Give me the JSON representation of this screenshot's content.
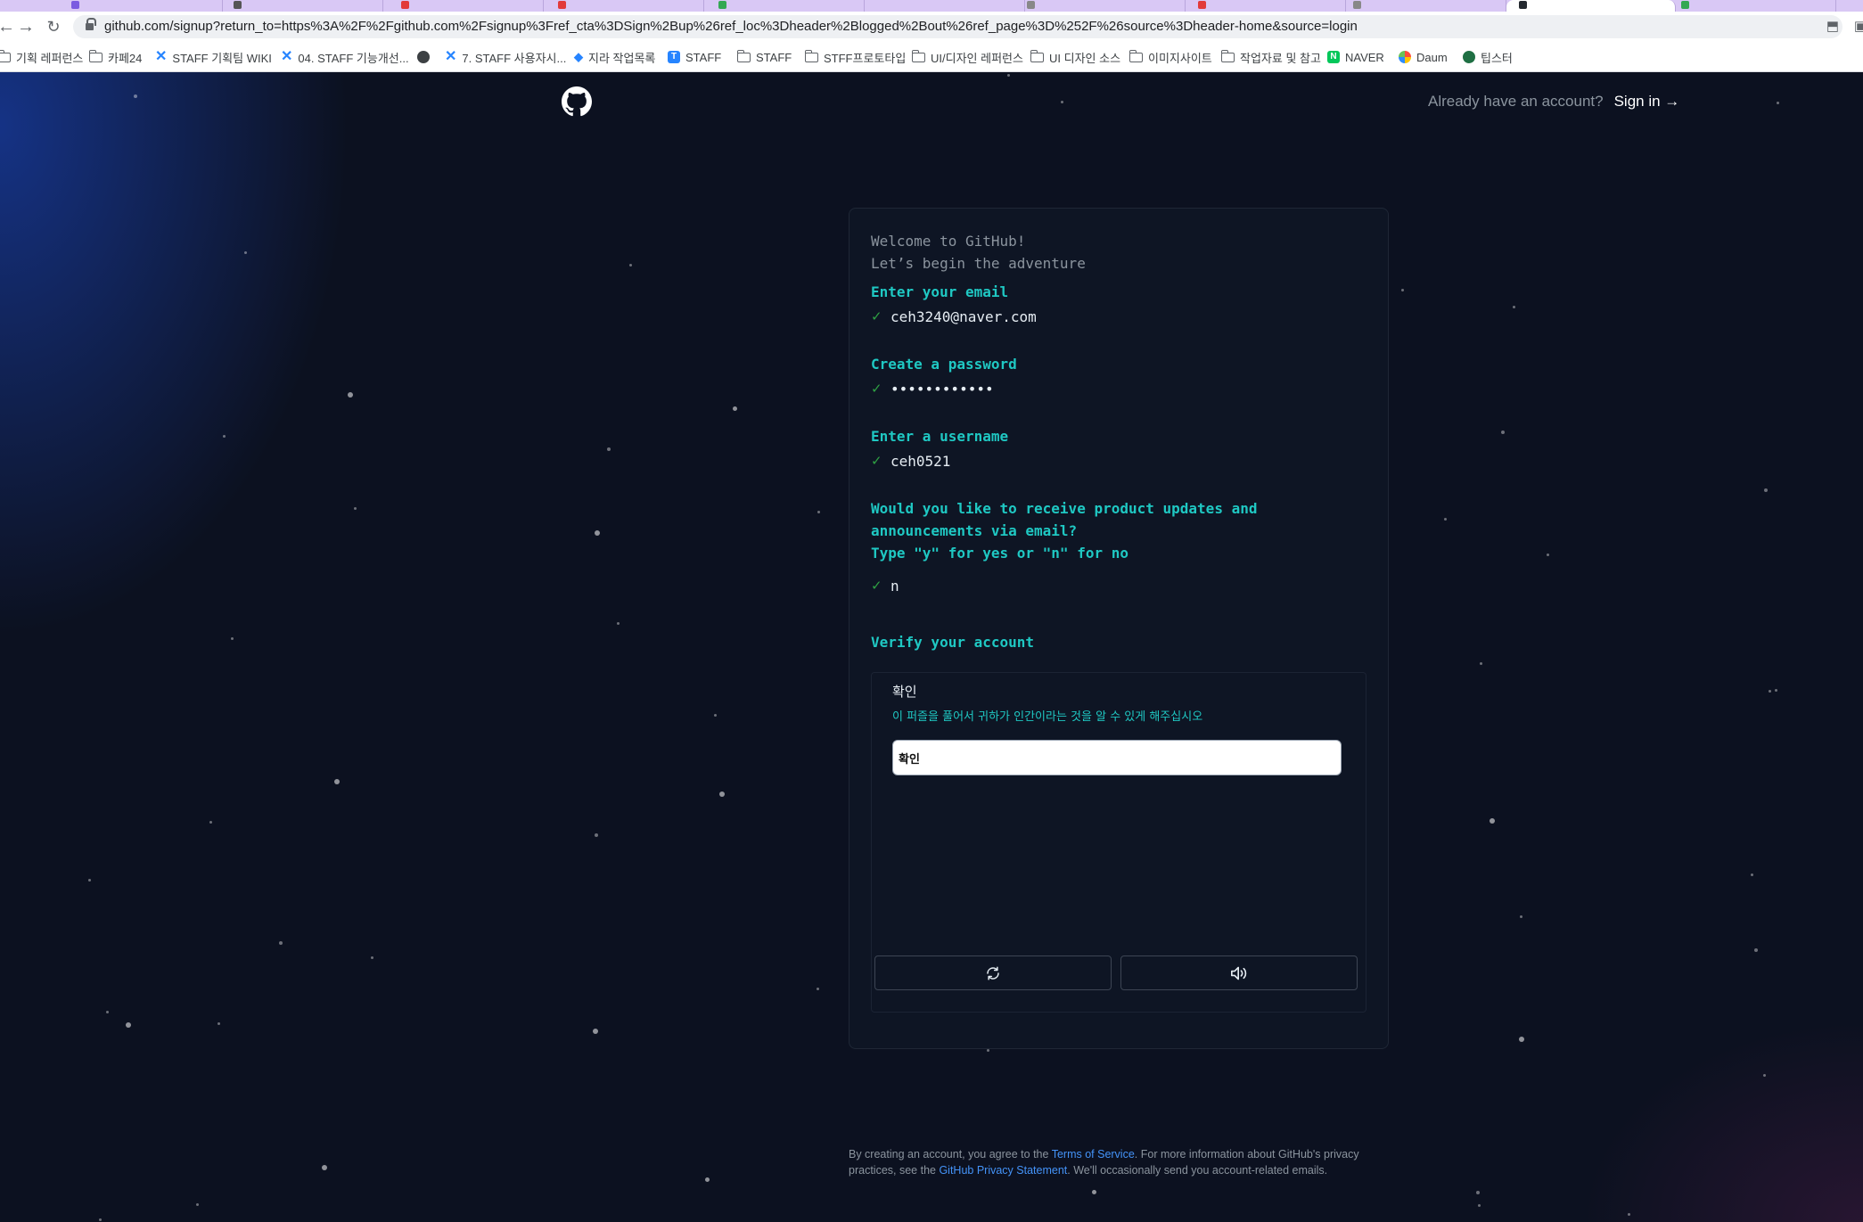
{
  "browser": {
    "url": "github.com/signup?return_to=https%3A%2F%2Fgithub.com%2Fsignup%3Fref_cta%3DSign%2Bup%26ref_loc%3Dheader%2Blogged%2Bout%26ref_page%3D%252F%26source%3Dheader-home&source=login",
    "nav_icons": [
      "back-arrow-icon",
      "forward-arrow-icon",
      "reload-icon"
    ],
    "toolbar_icons": [
      "install-app-icon",
      "extension-icon"
    ]
  },
  "bookmarks": [
    {
      "label": "기획 레퍼런스",
      "icon": "folder-icon"
    },
    {
      "label": "카페24",
      "icon": "folder-icon"
    },
    {
      "label": "STAFF 기획팀 WIKI",
      "icon": "confluence-icon"
    },
    {
      "label": "04. STAFF 기능개선...",
      "icon": "confluence-icon"
    },
    {
      "label": "",
      "icon": "globe-icon"
    },
    {
      "label": "7. STAFF 사용자시...",
      "icon": "confluence-icon"
    },
    {
      "label": "지라 작업목록",
      "icon": "jira-icon"
    },
    {
      "label": "STAFF",
      "icon": "staff-icon"
    },
    {
      "label": "STAFF",
      "icon": "folder-icon"
    },
    {
      "label": "STFF프로토타입",
      "icon": "folder-icon"
    },
    {
      "label": "UI/디자인 레퍼런스",
      "icon": "folder-icon"
    },
    {
      "label": "UI 디자인 소스",
      "icon": "folder-icon"
    },
    {
      "label": "이미지사이트",
      "icon": "folder-icon"
    },
    {
      "label": "작업자료 및 참고",
      "icon": "folder-icon"
    },
    {
      "label": "NAVER",
      "icon": "naver-icon"
    },
    {
      "label": "Daum",
      "icon": "daum-icon"
    },
    {
      "label": "팁스터",
      "icon": "tipster-icon"
    }
  ],
  "header": {
    "logo": "github-logo-icon",
    "account_question": "Already have an account?",
    "signin_label": "Sign in →"
  },
  "signup": {
    "welcome_line1": "Welcome to GitHub!",
    "welcome_line2": "Let’s begin the adventure",
    "email_label": "Enter your email",
    "email_value": "ceh3240@naver.com",
    "password_label": "Create a password",
    "password_value": "••••••••••••",
    "username_label": "Enter a username",
    "username_value": "ceh0521",
    "updates_q1": "Would you like to receive product updates and",
    "updates_q2": "announcements via email?",
    "updates_q3": "Type \"y\" for yes or \"n\" for no",
    "updates_value": "n",
    "verify_label": "Verify your account",
    "check_mark": "✓"
  },
  "verify": {
    "title": "확인",
    "instruction": "이 퍼즐을 풀어서 귀하가 인간이라는 것을 알 수 있게 해주십시오",
    "input_value": "확인",
    "buttons": [
      "refresh-icon",
      "audio-icon"
    ]
  },
  "footer": {
    "t1": "By creating an account, you agree to the ",
    "terms_link": "Terms of Service",
    "t2": ". For more information about GitHub's privacy practices, see the ",
    "privacy_link": "GitHub Privacy Statement",
    "t3": ". We'll occasionally send you account-related emails."
  },
  "colors": {
    "accent": "#1fc8c3",
    "success": "#2ea043",
    "link": "#4493f8",
    "page_bg": "#0c1120",
    "tab_strip": "#d9c8f5"
  }
}
